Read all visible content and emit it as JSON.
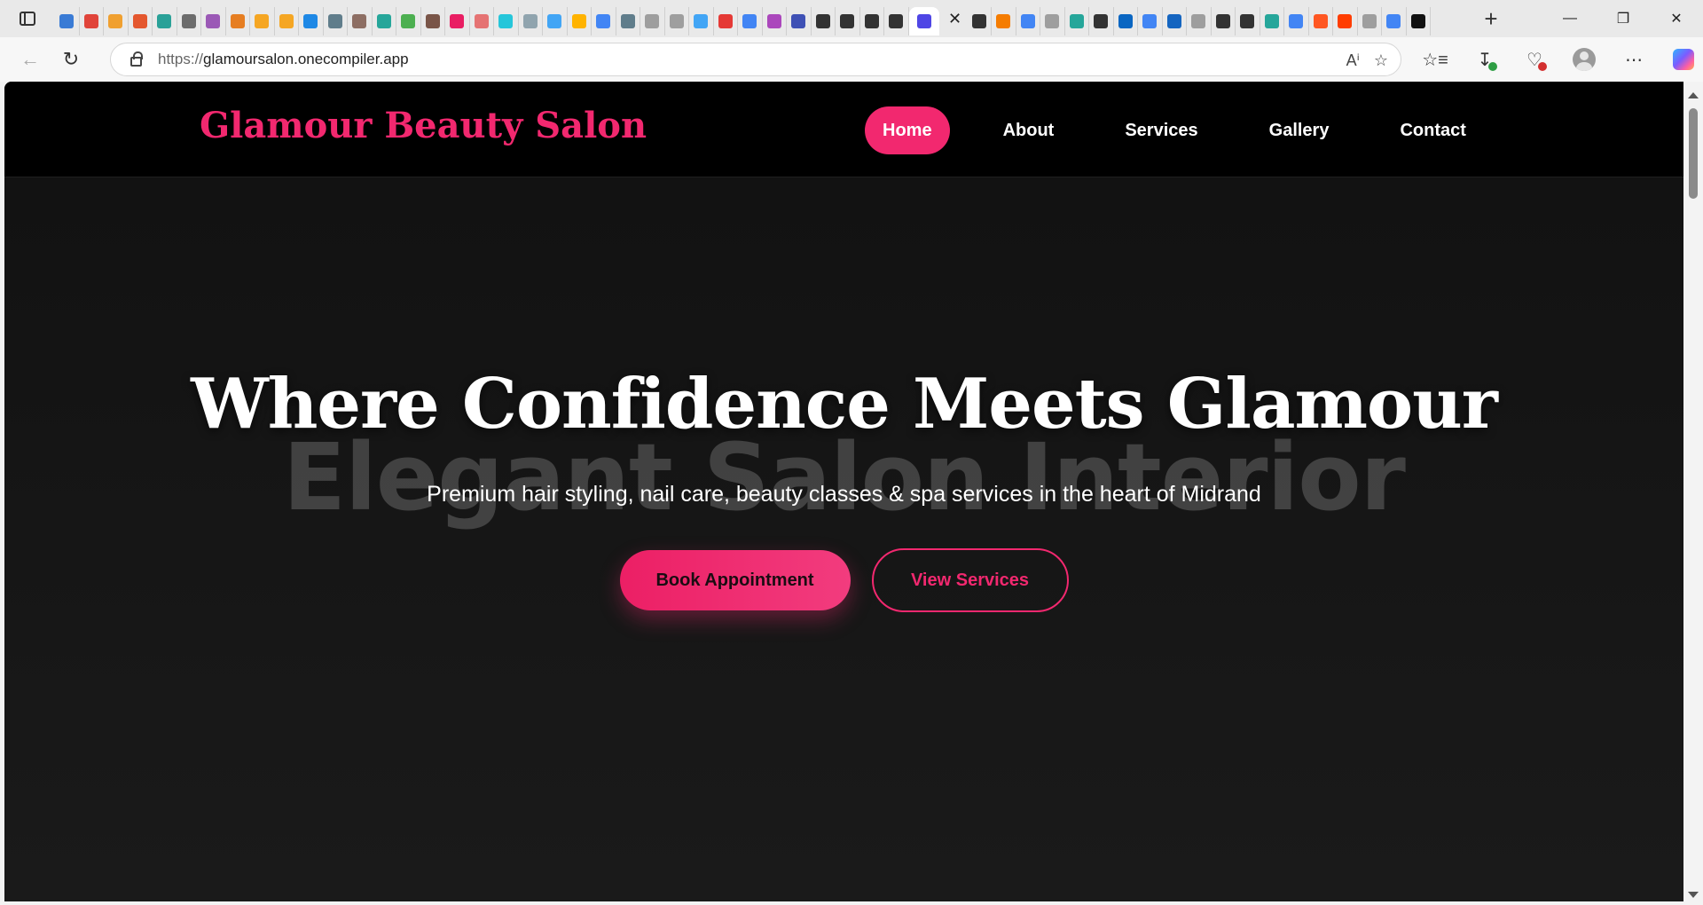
{
  "browser": {
    "tab_icon_colors": [
      "#3a7bd5",
      "#e0443a",
      "#f0a030",
      "#e4572e",
      "#2aa198",
      "#6c6c6c",
      "#9b59b6",
      "#e67e22",
      "#f5a623",
      "#f5a623",
      "#1e88e5",
      "#607d8b",
      "#8d6e63",
      "#26a69a",
      "#4caf50",
      "#795548",
      "#e91e63",
      "#e57373",
      "#26c6da",
      "#90a4ae",
      "#42a5f5",
      "#ffb300",
      "#4285f4",
      "#607d8b",
      "#9e9e9e",
      "#9e9e9e",
      "#42a5f5",
      "#e53935",
      "#4285f4",
      "#ab47bc",
      "#3f51b5",
      "#333333",
      "#333333",
      "#333333",
      "#333333",
      "#333333",
      "#f57c00",
      "#4285f4",
      "#9e9e9e",
      "#26a69a",
      "#333333",
      "#0a66c2",
      "#4285f4",
      "#1565c0",
      "#9e9e9e",
      "#333333",
      "#333333",
      "#26a69a",
      "#4285f4",
      "#ff5722",
      "#ff3d00",
      "#9e9e9e",
      "#4285f4",
      "#111111"
    ],
    "active_tab_icon": "code-icon",
    "active_tab_color": "#4f46e5",
    "address_bar": {
      "url_protocol": "https://",
      "url_host": "glamoursalon.onecompiler.app"
    }
  },
  "site": {
    "brand": "Glamour Beauty Salon",
    "brand_color": "#f2286f",
    "nav": [
      {
        "label": "Home",
        "active": true
      },
      {
        "label": "About",
        "active": false
      },
      {
        "label": "Services",
        "active": false
      },
      {
        "label": "Gallery",
        "active": false
      },
      {
        "label": "Contact",
        "active": false
      }
    ],
    "hero": {
      "background_alt_text": "Elegant Salon Interior",
      "title": "Where Confidence Meets Glamour",
      "subtitle": "Premium hair styling, nail care, beauty classes & spa services in the heart of Midrand",
      "primary_button": "Book Appointment",
      "secondary_button": "View Services"
    }
  }
}
